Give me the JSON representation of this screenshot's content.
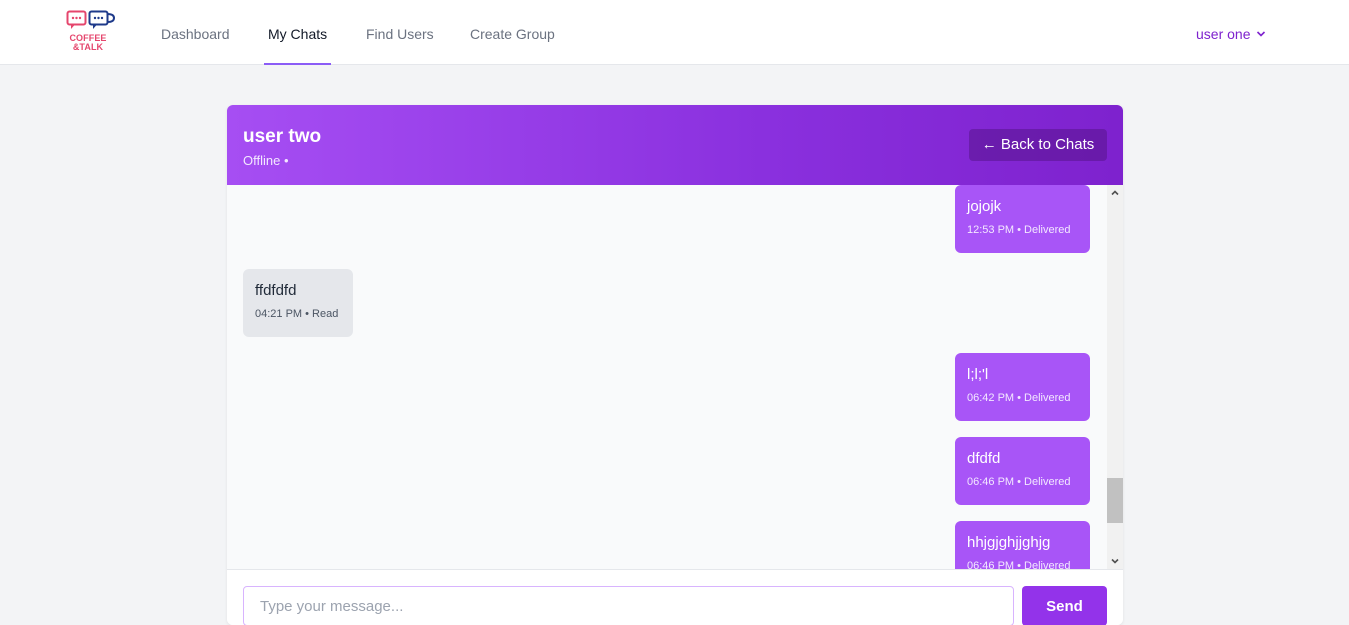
{
  "brand": {
    "line1": "COFFEE",
    "line2": "&TALK"
  },
  "nav": {
    "links": [
      {
        "label": "Dashboard"
      },
      {
        "label": "My Chats"
      },
      {
        "label": "Find Users"
      },
      {
        "label": "Create Group"
      }
    ],
    "active": "My Chats",
    "user_menu": "user one"
  },
  "chat": {
    "name": "user two",
    "status": "Offline •",
    "back_label": "← Back to Chats"
  },
  "messages": [
    {
      "direction": "sent",
      "text": "jojojk",
      "meta": "12:53 PM • Delivered"
    },
    {
      "direction": "received",
      "text": "ffdfdfd",
      "meta": "04:21 PM • Read"
    },
    {
      "direction": "sent",
      "text": "l;l;'l",
      "meta": "06:42 PM • Delivered"
    },
    {
      "direction": "sent",
      "text": "dfdfd",
      "meta": "06:46 PM • Delivered"
    },
    {
      "direction": "sent",
      "text": "hhjgjghjjghjg",
      "meta": "06:46 PM • Delivered"
    }
  ],
  "composer": {
    "placeholder": "Type your message...",
    "send_label": "Send"
  },
  "colors": {
    "accent": "#9333ea",
    "sent_bubble": "#a855f7",
    "received_bubble": "#e5e7eb",
    "header_gradient_start": "#a64ef3",
    "header_gradient_end": "#7e22ce"
  }
}
